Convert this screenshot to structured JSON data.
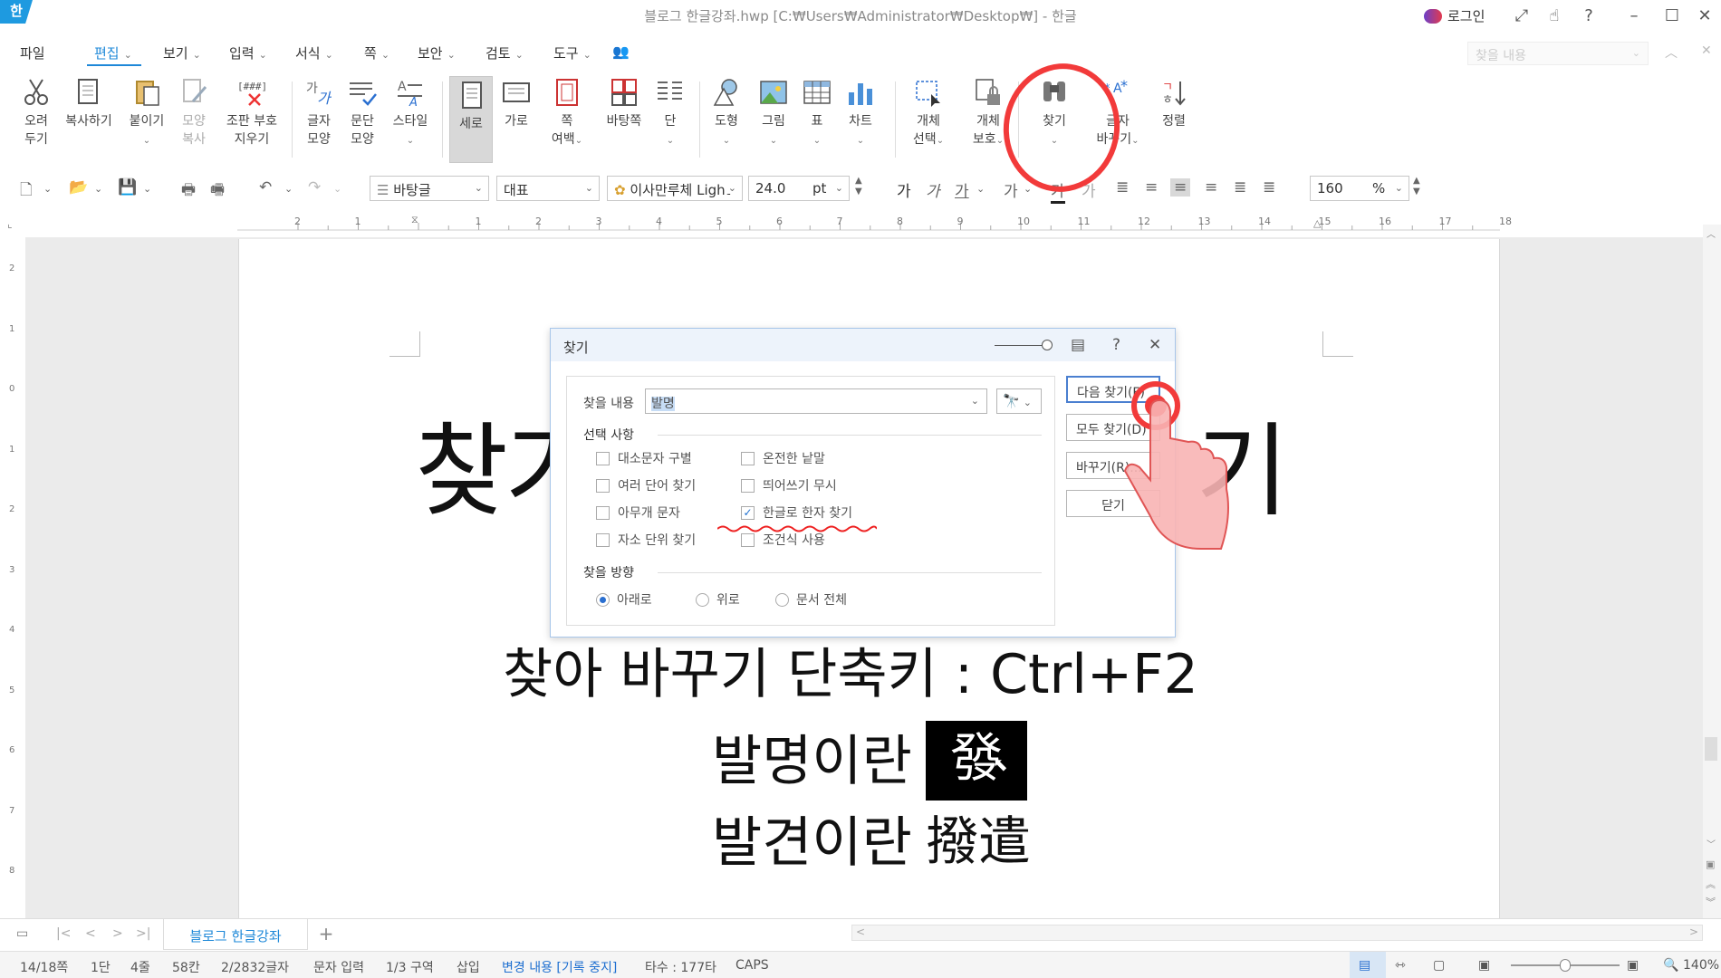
{
  "app": {
    "logo": "한",
    "title": "블로그 한글강좌.hwp [C:₩Users₩Administrator₩Desktop₩] - 한글",
    "login_label": "로그인"
  },
  "menu": {
    "items": [
      {
        "label": "파일"
      },
      {
        "label": "편집"
      },
      {
        "label": "보기"
      },
      {
        "label": "입력"
      },
      {
        "label": "서식"
      },
      {
        "label": "쪽"
      },
      {
        "label": "보안"
      },
      {
        "label": "검토"
      },
      {
        "label": "도구"
      }
    ],
    "search_placeholder": "찾을 내용"
  },
  "ribbon": {
    "cut": "오려\n두기",
    "copy": "복사하기",
    "paste": "붙이기",
    "format_copy": "모양\n복사",
    "clear_marks": "조판 부호\n지우기",
    "char_shape": "글자\n모양",
    "para_shape": "문단\n모양",
    "style": "스타일",
    "portrait": "세로",
    "landscape": "가로",
    "margins": "쪽\n여백",
    "book_margin": "바탕쪽",
    "columns": "단",
    "shapes": "도형",
    "picture": "그림",
    "table": "표",
    "chart": "차트",
    "select_obj": "개체\n선택",
    "protect_obj": "개체\n보호",
    "find": "찾기",
    "replace_char": "글자\n바꾸기",
    "sort": "정렬"
  },
  "format_bar": {
    "style": "바탕글",
    "lang": "대표",
    "font": "이사만루체 Light",
    "size": "24.0",
    "unit": "pt",
    "zoom": "160",
    "zoom_unit": "%"
  },
  "ruler": {
    "numbers": [
      "2",
      "1",
      "1",
      "2",
      "3",
      "4",
      "5",
      "6",
      "7",
      "8",
      "9",
      "10",
      "11",
      "12",
      "13",
      "14",
      "15",
      "16",
      "17",
      "18"
    ],
    "vnumbers": [
      "2",
      "1",
      "0",
      "1",
      "2",
      "3",
      "4",
      "5",
      "6",
      "7",
      "8"
    ]
  },
  "document": {
    "title_left": "찾기",
    "title_right": "기",
    "line2": "찾아 바꾸기 단축키 : Ctrl+F2",
    "line3": "발명이란",
    "hanja1": "發明",
    "line4": "발견이란",
    "hanja2": "撥遣"
  },
  "find_dialog": {
    "title": "찾기",
    "find_label": "찾을 내용",
    "find_value": "발명",
    "options_label": "선택 사항",
    "options": [
      {
        "label": "대소문자 구별",
        "checked": false
      },
      {
        "label": "여러 단어 찾기",
        "checked": false
      },
      {
        "label": "아무개 문자",
        "checked": false
      },
      {
        "label": "자소 단위 찾기",
        "checked": false
      },
      {
        "label": "온전한 낱말",
        "checked": false
      },
      {
        "label": "띄어쓰기 무시",
        "checked": false
      },
      {
        "label": "한글로 한자 찾기",
        "checked": true
      },
      {
        "label": "조건식 사용",
        "checked": false
      }
    ],
    "direction_label": "찾을 방향",
    "directions": [
      {
        "label": "아래로",
        "selected": true
      },
      {
        "label": "위로",
        "selected": false
      },
      {
        "label": "문서 전체",
        "selected": false
      }
    ],
    "buttons": {
      "find_next": "다음 찾기(F)",
      "find_all": "모두 찾기(D)",
      "replace": "바꾸기(R)...",
      "close": "닫기"
    }
  },
  "tabs": {
    "doc_tab": "블로그 한글강좌",
    "add": "+"
  },
  "status": {
    "page": "14/18쪽",
    "col": "1단",
    "line": "4줄",
    "char_pos": "58칸",
    "chars": "2/2832글자",
    "mode": "문자 입력",
    "section": "1/3 구역",
    "insert": "삽입",
    "track": "변경 내용 [기록 중지]",
    "typing": "타수 : 177타",
    "caps": "CAPS",
    "zoom": "140%"
  },
  "colors": {
    "accent": "#1e88d8",
    "annotation_red": "#f23a3a",
    "dialog_border": "#a8c6ea"
  }
}
